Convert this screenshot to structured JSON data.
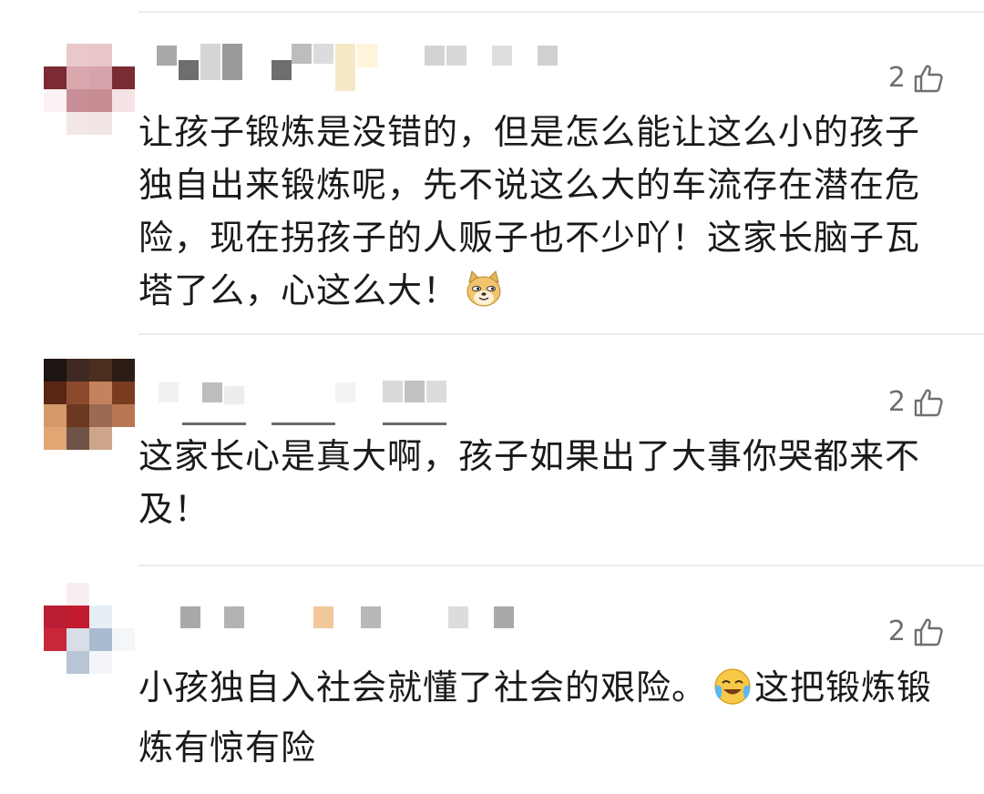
{
  "comments": [
    {
      "likes": "2",
      "text": "让孩子锻炼是没错的，但是怎么能让这么小的孩子独自出来锻炼呢，先不说这么大的车流存在潜在危险，现在拐孩子的人贩子也不少吖！这家长脑子瓦塔了么，心这么大！",
      "emoji": "doge-emoji"
    },
    {
      "likes": "2",
      "text": "这家长心是真大啊，孩子如果出了大事你哭都来不及！"
    },
    {
      "likes": "2",
      "text_before_emoji": "小孩独自入社会就懂了社会的艰险。",
      "emoji": "crying-laughing-emoji",
      "text_after_emoji": "这把锻炼锻炼有惊有险"
    }
  ],
  "icons": {
    "like": "thumbs-up-icon"
  },
  "colors": {
    "text": "#1a1a1a",
    "like_count": "#6f6f6f",
    "divider": "#ececec"
  }
}
